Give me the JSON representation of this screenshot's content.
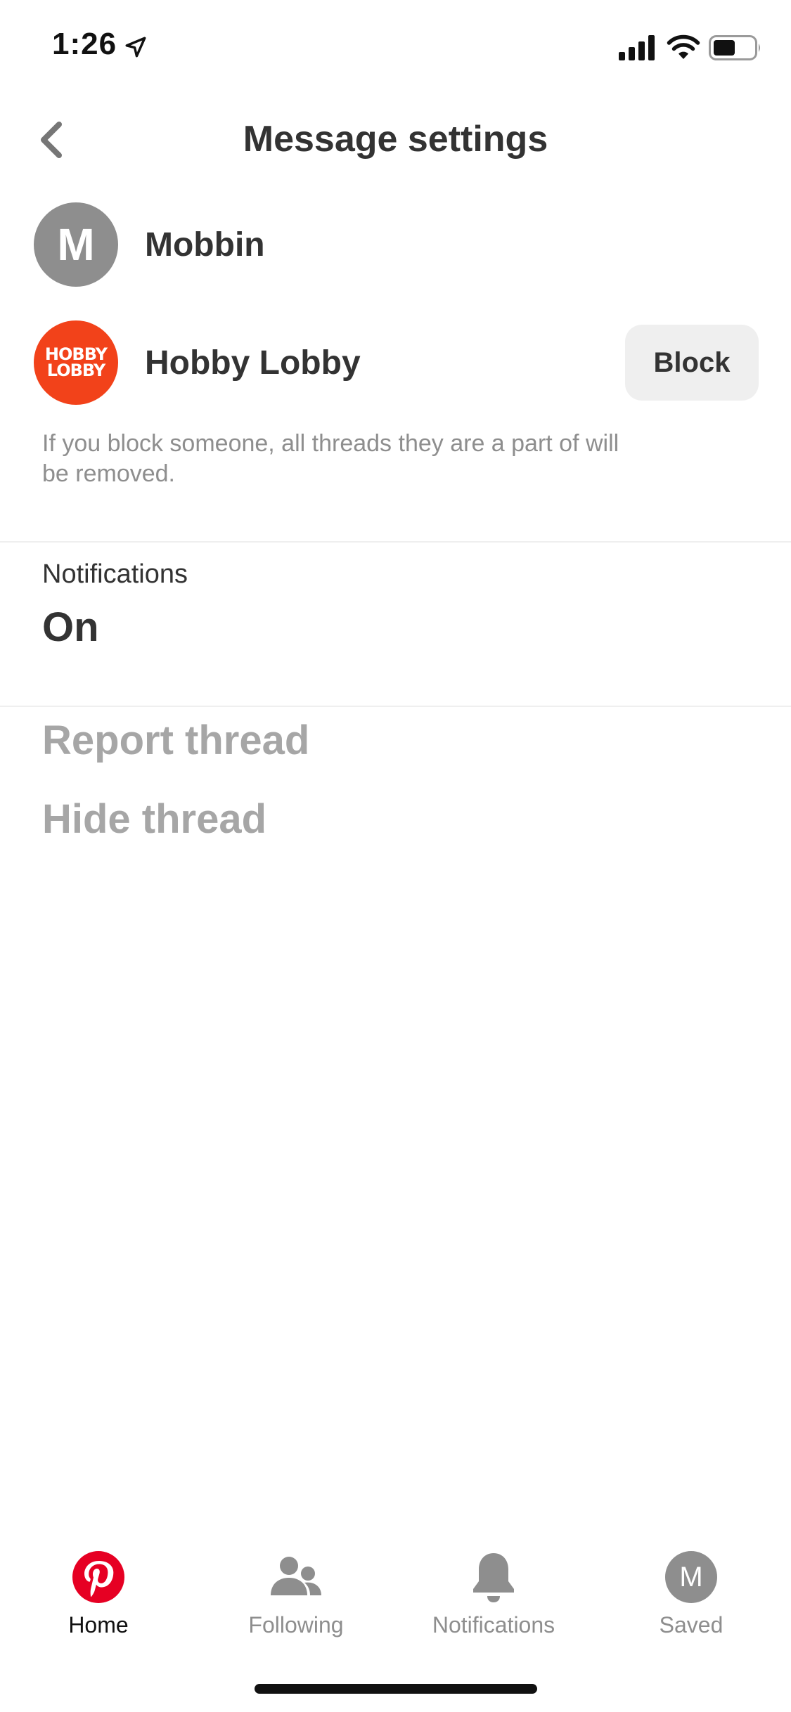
{
  "status_bar": {
    "time": "1:26",
    "icons": [
      "location-arrow-icon",
      "signal-icon",
      "wifi-icon",
      "battery-icon"
    ]
  },
  "header": {
    "title": "Message settings",
    "back_icon": "chevron-left-icon"
  },
  "participants": [
    {
      "name": "Mobbin",
      "avatar_letter": "M",
      "avatar_color": "#8e8e8e"
    },
    {
      "name": "Hobby Lobby",
      "avatar_logo": [
        "HOBBY",
        "LOBBY"
      ],
      "avatar_color": "#f2421a",
      "block_label": "Block"
    }
  ],
  "block_help_text": "If you block someone, all threads they are a part of will be removed.",
  "notifications": {
    "label": "Notifications",
    "value": "On"
  },
  "actions": {
    "report": "Report thread",
    "hide": "Hide thread"
  },
  "bottom_nav": {
    "items": [
      {
        "label": "Home",
        "icon": "pinterest-logo-icon",
        "active": true
      },
      {
        "label": "Following",
        "icon": "people-icon",
        "active": false
      },
      {
        "label": "Notifications",
        "icon": "bell-icon",
        "active": false
      },
      {
        "label": "Saved",
        "icon": "profile-avatar-icon",
        "avatar_letter": "M",
        "active": false
      }
    ]
  },
  "colors": {
    "text_primary": "#333333",
    "text_secondary": "#8e8e8e",
    "text_disabled": "#a6a6a6",
    "button_bg": "#efefef",
    "brand_red": "#e60023"
  }
}
